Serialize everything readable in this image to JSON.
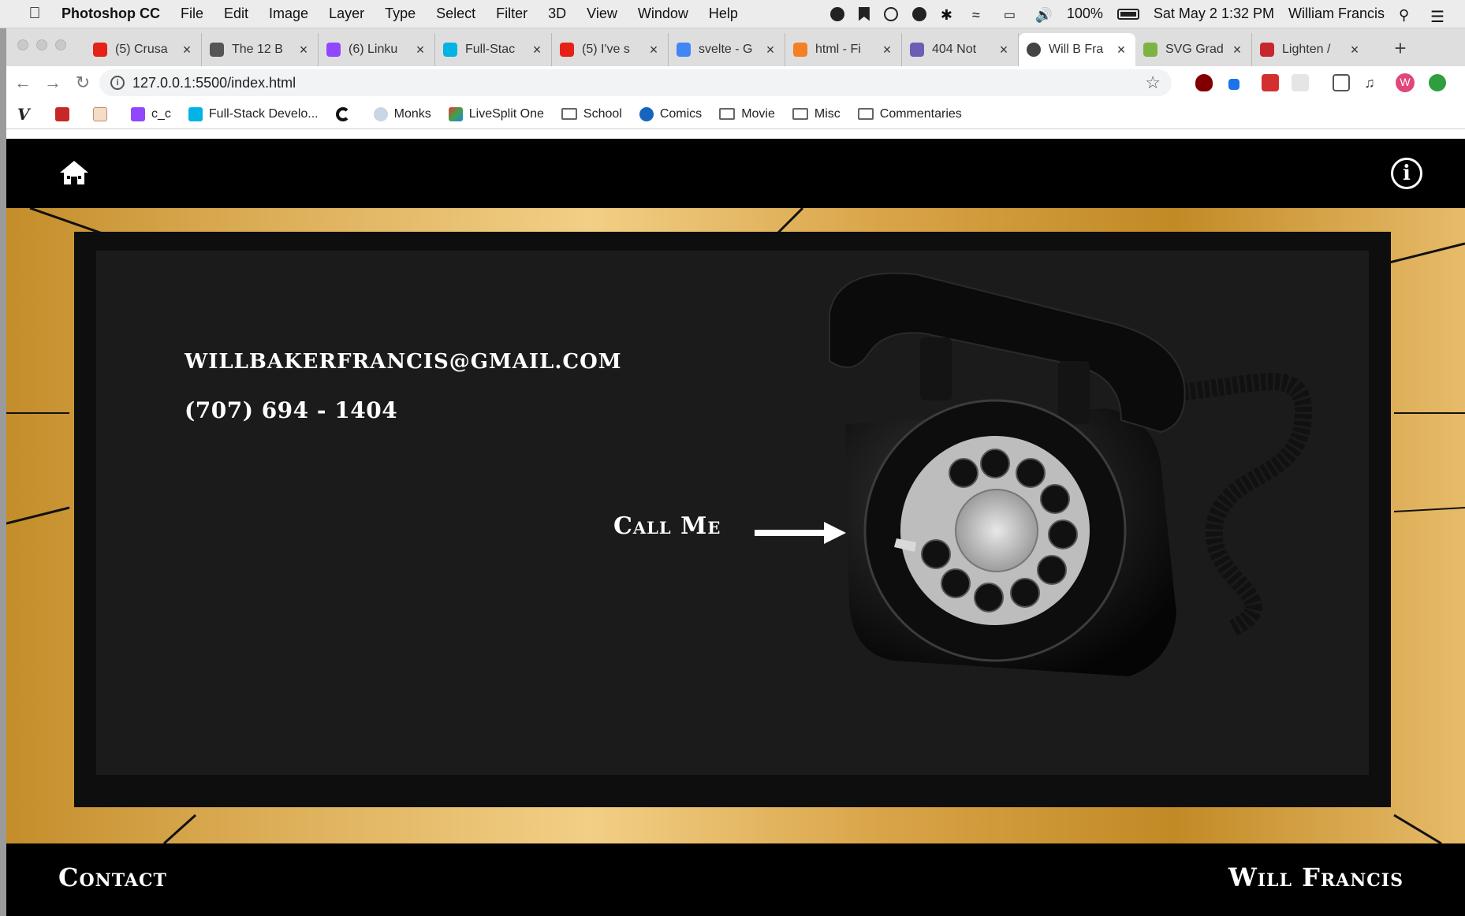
{
  "menubar": {
    "app_name": "Photoshop CC",
    "menus": [
      "File",
      "Edit",
      "Image",
      "Layer",
      "Type",
      "Select",
      "Filter",
      "3D",
      "View",
      "Window",
      "Help"
    ],
    "battery": "100%",
    "datetime": "Sat May 2  1:32 PM",
    "user": "William Francis"
  },
  "tabs": [
    {
      "title": "(5) Crusa",
      "icon": "youtube-icon",
      "color": "#e62117"
    },
    {
      "title": "The 12 B",
      "icon": "wifi-icon",
      "color": "#555555"
    },
    {
      "title": "(6) Linku",
      "icon": "twitch-icon",
      "color": "#9146ff"
    },
    {
      "title": "Full-Stac",
      "icon": "udacity-icon",
      "color": "#02b3e4"
    },
    {
      "title": "(5) I've s",
      "icon": "youtube-icon",
      "color": "#e62117"
    },
    {
      "title": "svelte - G",
      "icon": "google-icon",
      "color": "#4285f4"
    },
    {
      "title": "html - Fi",
      "icon": "stackoverflow-icon",
      "color": "#f48024"
    },
    {
      "title": "404 Not",
      "icon": "stripes-icon",
      "color": "#6b5fb5"
    },
    {
      "title": "Will B Fra",
      "icon": "globe-icon",
      "color": "#444444"
    },
    {
      "title": "SVG Grad",
      "icon": "chart-icon",
      "color": "#7cb342"
    },
    {
      "title": "Lighten /",
      "icon": "sass-icon",
      "color": "#c6262e"
    }
  ],
  "omnibox": {
    "url": "127.0.0.1:5500/index.html"
  },
  "bookmarks": [
    {
      "label": "",
      "icon": "v-logo-icon"
    },
    {
      "label": "",
      "icon": "tnr-icon"
    },
    {
      "label": "",
      "icon": "ft-icon"
    },
    {
      "label": "c_c",
      "icon": "twitch-icon"
    },
    {
      "label": "Full-Stack Develo...",
      "icon": "udacity-icon"
    },
    {
      "label": "",
      "icon": "c-logo-icon"
    },
    {
      "label": "Monks",
      "icon": "wordpress-icon"
    },
    {
      "label": "LiveSplit One",
      "icon": "livesplit-icon"
    },
    {
      "label": "School",
      "icon": "folder-icon"
    },
    {
      "label": "Comics",
      "icon": "dc-icon"
    },
    {
      "label": "Movie",
      "icon": "folder-icon"
    },
    {
      "label": "Misc",
      "icon": "folder-icon"
    },
    {
      "label": "Commentaries",
      "icon": "folder-icon"
    }
  ],
  "site": {
    "email": "WILLBAKERFRANCIS@GMAIL.COM",
    "phone": "(707) 694 - 1404",
    "call_me": "Call Me",
    "footer_left": "Contact",
    "footer_right": "Will Francis",
    "avatar_letter": "W"
  },
  "colors": {
    "header_bg": "#000000",
    "panel_bg": "#1b1b1b",
    "wood": "#d9a951",
    "text": "#ffffff"
  }
}
